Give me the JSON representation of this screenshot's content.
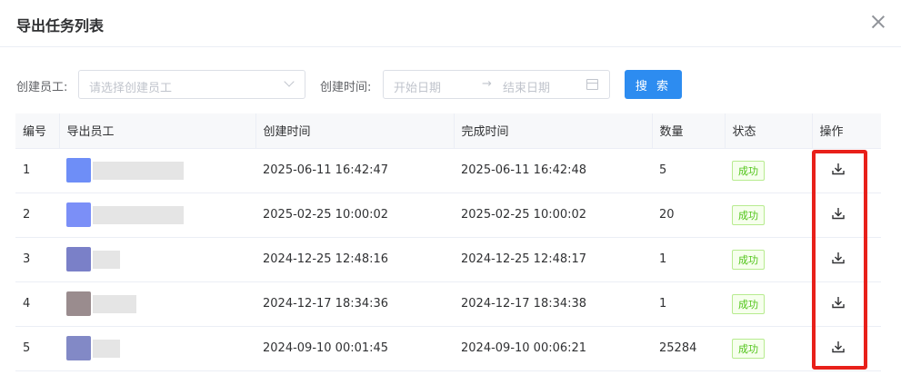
{
  "dialog": {
    "title": "导出任务列表",
    "close_icon": "close-icon"
  },
  "filters": {
    "employee_label": "创建员工:",
    "employee_placeholder": "请选择创建员工",
    "time_label": "创建时间:",
    "start_placeholder": "开始日期",
    "end_placeholder": "结束日期",
    "range_separator": "→",
    "search_label": "搜 索"
  },
  "table": {
    "columns": [
      "编号",
      "导出员工",
      "创建时间",
      "完成时间",
      "数量",
      "状态",
      "操作"
    ],
    "rows": [
      {
        "id": "1",
        "created": "2025-06-11 16:42:47",
        "finished": "2025-06-11 16:42:48",
        "count": "5",
        "status": "成功"
      },
      {
        "id": "2",
        "created": "2025-02-25 10:00:02",
        "finished": "2025-02-25 10:00:02",
        "count": "20",
        "status": "成功"
      },
      {
        "id": "3",
        "created": "2024-12-25 12:48:16",
        "finished": "2024-12-25 12:48:17",
        "count": "1",
        "status": "成功"
      },
      {
        "id": "4",
        "created": "2024-12-17 18:34:36",
        "finished": "2024-12-17 18:34:38",
        "count": "1",
        "status": "成功"
      },
      {
        "id": "5",
        "created": "2024-09-10 00:01:45",
        "finished": "2024-09-10 00:06:21",
        "count": "25284",
        "status": "成功"
      }
    ]
  },
  "colors": {
    "primary": "#2d8cf0",
    "success_text": "#52c41a",
    "success_border": "#b7eb8f",
    "highlight": "#e8201a",
    "avatars": [
      "#6e8ef7",
      "#7b8ff7",
      "#7a80c8",
      "#9a8c8e",
      "#8289c6"
    ]
  }
}
